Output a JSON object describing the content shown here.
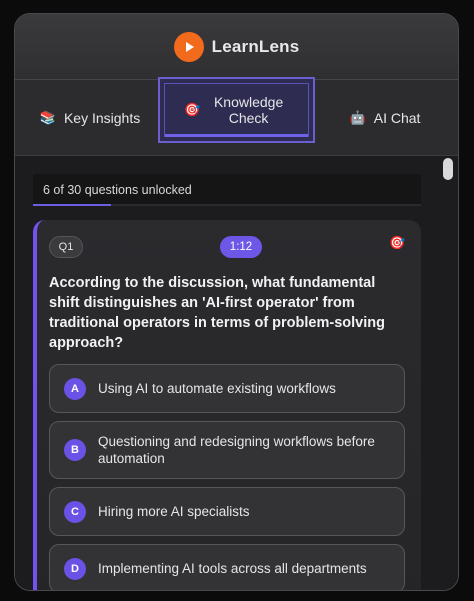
{
  "app": {
    "title": "LearnLens",
    "logo_icon": "play-icon",
    "brand_color": "#f26a1b",
    "accent_color": "#6b52e6"
  },
  "tabs": [
    {
      "label": "Key Insights",
      "icon": "books-icon",
      "active": false
    },
    {
      "label": "Knowledge Check",
      "icon": "dart-icon",
      "active": true
    },
    {
      "label": "AI Chat",
      "icon": "robot-icon",
      "active": false
    }
  ],
  "progress": {
    "text": "6 of 30 questions unlocked",
    "unlocked": 6,
    "total": 30
  },
  "quiz": {
    "question_number": "Q1",
    "timer": "1:12",
    "question": "According to the discussion, what fundamental shift distinguishes an 'AI-first operator' from traditional operators in terms of problem-solving approach?",
    "options": [
      {
        "letter": "A",
        "text": "Using AI to automate existing workflows"
      },
      {
        "letter": "B",
        "text": "Questioning and redesigning workflows before automation"
      },
      {
        "letter": "C",
        "text": "Hiring more AI specialists"
      },
      {
        "letter": "D",
        "text": "Implementing AI tools across all departments"
      }
    ]
  }
}
